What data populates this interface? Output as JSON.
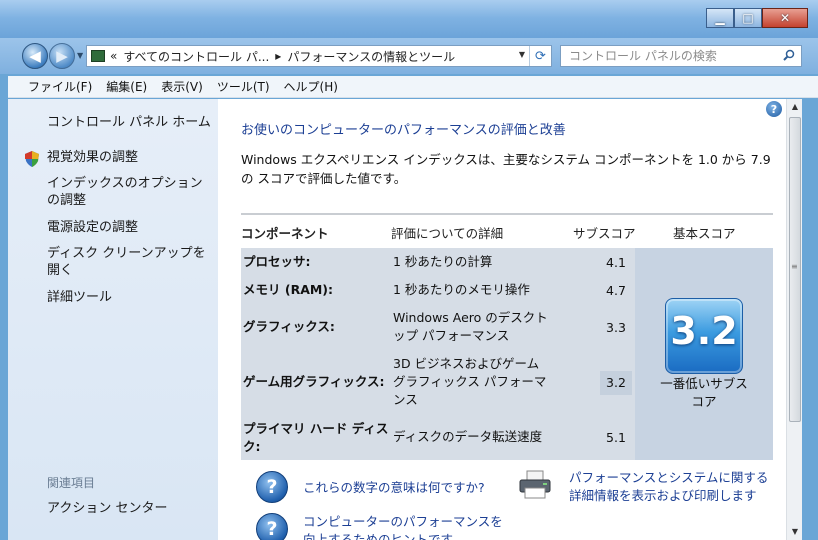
{
  "window": {
    "minimize": "▁",
    "maximize": "□",
    "close": "✕"
  },
  "nav": {
    "back_icon": "back-arrow-icon",
    "forward_icon": "forward-arrow-icon",
    "address_sep": "«",
    "address_crumb1": "すべてのコントロール パ...",
    "address_arrow": "▸",
    "address_crumb2": "パフォーマンスの情報とツール",
    "search_placeholder": "コントロール パネルの検索"
  },
  "menu": {
    "file": "ファイル(F)",
    "edit": "編集(E)",
    "view": "表示(V)",
    "tools": "ツール(T)",
    "help": "ヘルプ(H)"
  },
  "sidebar": {
    "home": "コントロール パネル ホーム",
    "visual_effects": "視覚効果の調整",
    "index_options": "インデックスのオプションの調整",
    "power_settings": "電源設定の調整",
    "disk_cleanup": "ディスク クリーンアップを開く",
    "advanced_tools": "詳細ツール",
    "related_heading": "関連項目",
    "action_center": "アクション センター"
  },
  "main": {
    "heading": "お使いのコンピューターのパフォーマンスの評価と改善",
    "description": "Windows エクスペリエンス インデックスは、主要なシステム コンポーネントを 1.0 から 7.9 の スコアで評価した値です。",
    "col_component": "コンポーネント",
    "col_detail": "評価についての詳細",
    "col_subscore": "サブスコア",
    "col_basescore": "基本スコア",
    "rows": [
      {
        "component": "プロセッサ:",
        "detail": "1 秒あたりの計算",
        "subscore": "4.1"
      },
      {
        "component": "メモリ (RAM):",
        "detail": "1 秒あたりのメモリ操作",
        "subscore": "4.7"
      },
      {
        "component": "グラフィックス:",
        "detail": "Windows Aero のデスクトップ パフォーマンス",
        "subscore": "3.3"
      },
      {
        "component": "ゲーム用グラフィックス:",
        "detail": "3D ビジネスおよびゲーム グラフィックス パフォーマンス",
        "subscore": "3.2"
      },
      {
        "component": "プライマリ ハード ディスク:",
        "detail": "ディスクのデータ転送速度",
        "subscore": "5.1"
      }
    ],
    "base_score": "3.2",
    "base_caption": "一番低いサブスコア",
    "link_meaning": "これらの数字の意味は何ですか?",
    "link_print": "パフォーマンスとシステムに関する詳細情報を表示および印刷します",
    "link_improve": "コンピューターのパフォーマンスを向上するためのヒントです"
  }
}
